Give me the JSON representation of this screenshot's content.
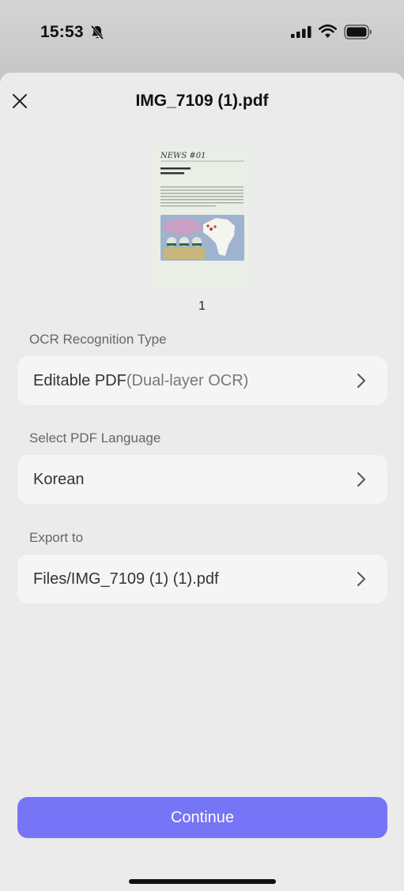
{
  "status_bar": {
    "time": "15:53",
    "icons": [
      "bell-slash-icon",
      "signal-icon",
      "wifi-icon",
      "battery-icon"
    ]
  },
  "sheet": {
    "title": "IMG_7109 (1).pdf",
    "close_icon": "close-icon",
    "preview": {
      "page_number": "1",
      "thumb_heading": "NEWS #01"
    },
    "sections": [
      {
        "label": "OCR Recognition Type",
        "value": "Editable PDF",
        "value_detail": "(Dual-layer OCR)"
      },
      {
        "label": "Select PDF Language",
        "value": "Korean"
      },
      {
        "label": "Export to",
        "value": "Files/IMG_7109 (1) (1).pdf"
      }
    ],
    "continue_label": "Continue"
  },
  "colors": {
    "accent": "#7675f8",
    "sheet_background": "#ebebeb",
    "row_background": "#f5f5f5"
  }
}
